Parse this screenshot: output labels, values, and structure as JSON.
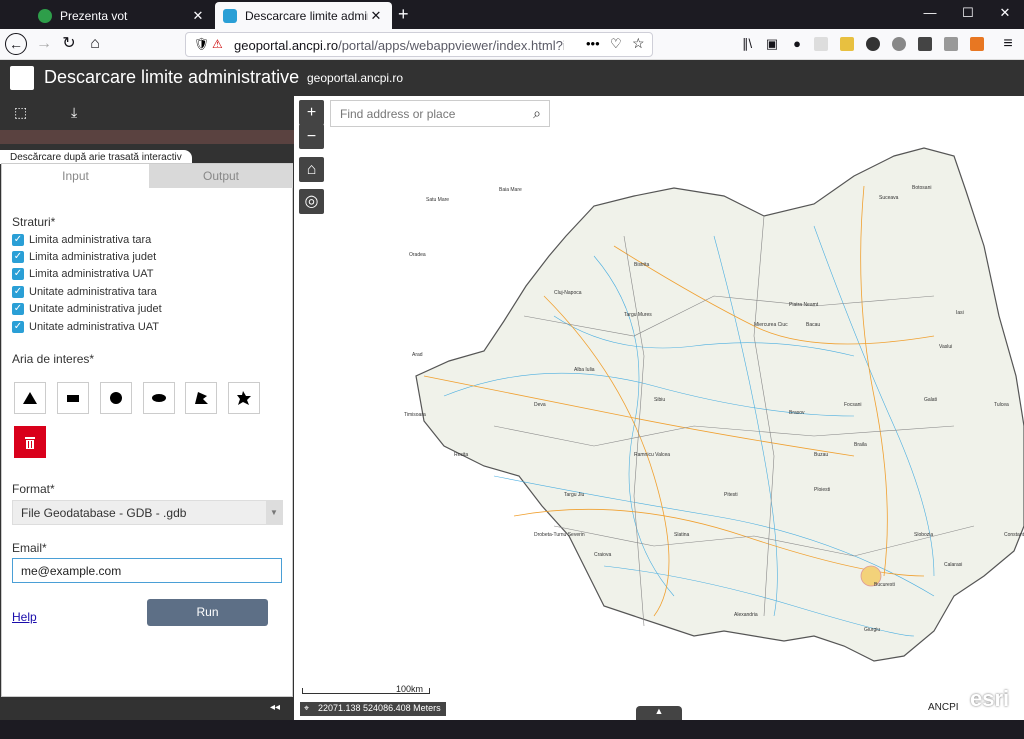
{
  "browser": {
    "tabs": [
      {
        "label": "Prezenta vot",
        "close": "✕"
      },
      {
        "label": "Descarcare limite administrative",
        "close": "✕"
      }
    ],
    "new_tab": "+",
    "url_domain": "geoportal.ancpi.ro",
    "url_path": "/portal/apps/webappviewer/index.html?id=faeb",
    "window_controls": {
      "minimize": "—",
      "maximize": "☐",
      "close": "✕"
    }
  },
  "app": {
    "title": "Descarcare limite administrative",
    "subtitle": "geoportal.ancpi.ro"
  },
  "panel": {
    "label": "Descărcare după arie trasată interactiv",
    "tabs": {
      "input": "Input",
      "output": "Output"
    },
    "layers_title": "Straturi*",
    "layers": [
      "Limita administrativa tara",
      "Limita administrativa judet",
      "Limita administrativa UAT",
      "Unitate administrativa tara",
      "Unitate administrativa judet",
      "Unitate administrativa UAT"
    ],
    "area_title": "Aria de interes*",
    "format_title": "Format*",
    "format_value": "File Geodatabase - GDB - .gdb",
    "email_title": "Email*",
    "email_value": "me@example.com",
    "help": "Help",
    "run": "Run"
  },
  "map": {
    "search_placeholder": "Find address or place",
    "zoom_in": "+",
    "zoom_out": "−",
    "scale_label": "100km",
    "coords": "22071.138 524086.408 Meters",
    "attribution": "ANCPI",
    "esri": "esri",
    "toggle": "▲",
    "cities": [
      "Satu Mare",
      "Baia Mare",
      "Suceava",
      "Botosani",
      "Oradea",
      "Cluj-Napoca",
      "Bistrita",
      "Piatra Neamt",
      "Iasi",
      "Vaslui",
      "Targu Mures",
      "Bacau",
      "Arad",
      "Alba Iulia",
      "Miercurea Ciuc",
      "Timisoara",
      "Deva",
      "Sibiu",
      "Brasov",
      "Focsani",
      "Galati",
      "Resita",
      "Ramnicu Valcea",
      "Buzau",
      "Braila",
      "Tulcea",
      "Targu Jiu",
      "Pitesti",
      "Ploiesti",
      "Drobeta-Turnu Severin",
      "Slatina",
      "Craiova",
      "Bucuresti",
      "Calarasi",
      "Constanta",
      "Giurgiu",
      "Alexandria",
      "Slobozia"
    ]
  }
}
